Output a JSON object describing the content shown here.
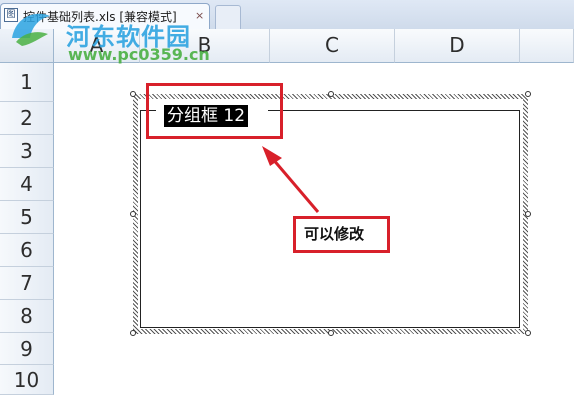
{
  "tab": {
    "file_icon": "excel-file-icon",
    "title": "控件基础列表.xls  [兼容模式]",
    "close": "×"
  },
  "watermark": {
    "name": "河东软件园",
    "url": "www.pc0359.cn"
  },
  "columns": [
    "A",
    "B",
    "C",
    "D"
  ],
  "rows": [
    "1",
    "2",
    "3",
    "4",
    "5",
    "6",
    "7",
    "8",
    "9",
    "10"
  ],
  "groupbox": {
    "caption": "分组框 12"
  },
  "callout": {
    "text": "可以修改"
  },
  "colors": {
    "highlight": "#d8202a",
    "header_bg": "#e4ebf4",
    "watermark_blue": "#2aa2e0",
    "watermark_green": "#4ab043"
  }
}
